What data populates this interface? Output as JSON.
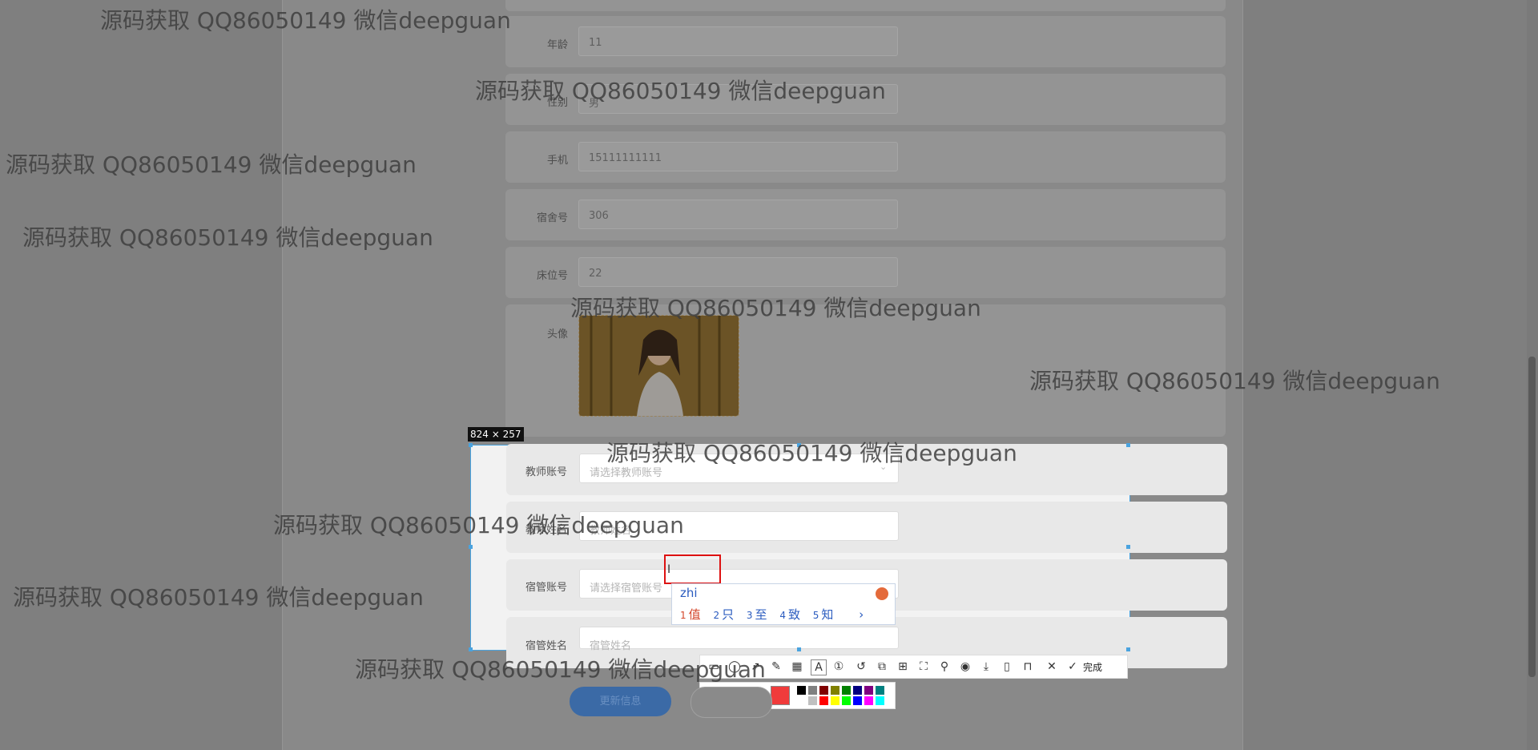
{
  "form": {
    "age": {
      "label": "年龄",
      "value": "11"
    },
    "gender": {
      "label": "性别",
      "value": "男"
    },
    "phone": {
      "label": "手机",
      "value": "15111111111"
    },
    "dorm_no": {
      "label": "宿舍号",
      "value": "306"
    },
    "bed_no": {
      "label": "床位号",
      "value": "22"
    },
    "avatar": {
      "label": "头像"
    },
    "teacher_account": {
      "label": "教师账号",
      "placeholder": "请选择教师账号"
    },
    "teacher_name": {
      "label": "教师姓名",
      "placeholder": "教师姓名"
    },
    "dorm_manager_account": {
      "label": "宿管账号",
      "placeholder": "请选择宿管账号"
    },
    "dorm_manager_name": {
      "label": "宿管姓名",
      "placeholder": "宿管姓名"
    },
    "update_button": "更新信息"
  },
  "screenshot_tool": {
    "dimension_label": "824 × 257",
    "done_label": "完成",
    "font_size": "16",
    "selected_color": "#f03b3b",
    "palette": [
      "#000000",
      "#808080",
      "#800000",
      "#808000",
      "#008000",
      "#000080",
      "#800080",
      "#008080",
      "#ffffff",
      "#c0c0c0",
      "#ff0000",
      "#ffff00",
      "#00ff00",
      "#0000ff",
      "#ff00ff",
      "#00ffff"
    ]
  },
  "ime": {
    "pinyin": "zhi",
    "candidates": [
      {
        "num": "1",
        "char": "值"
      },
      {
        "num": "2",
        "char": "只"
      },
      {
        "num": "3",
        "char": "至"
      },
      {
        "num": "4",
        "char": "致"
      },
      {
        "num": "5",
        "char": "知"
      }
    ],
    "next": "›"
  },
  "watermark": "源码获取 QQ86050149 微信deepguan"
}
